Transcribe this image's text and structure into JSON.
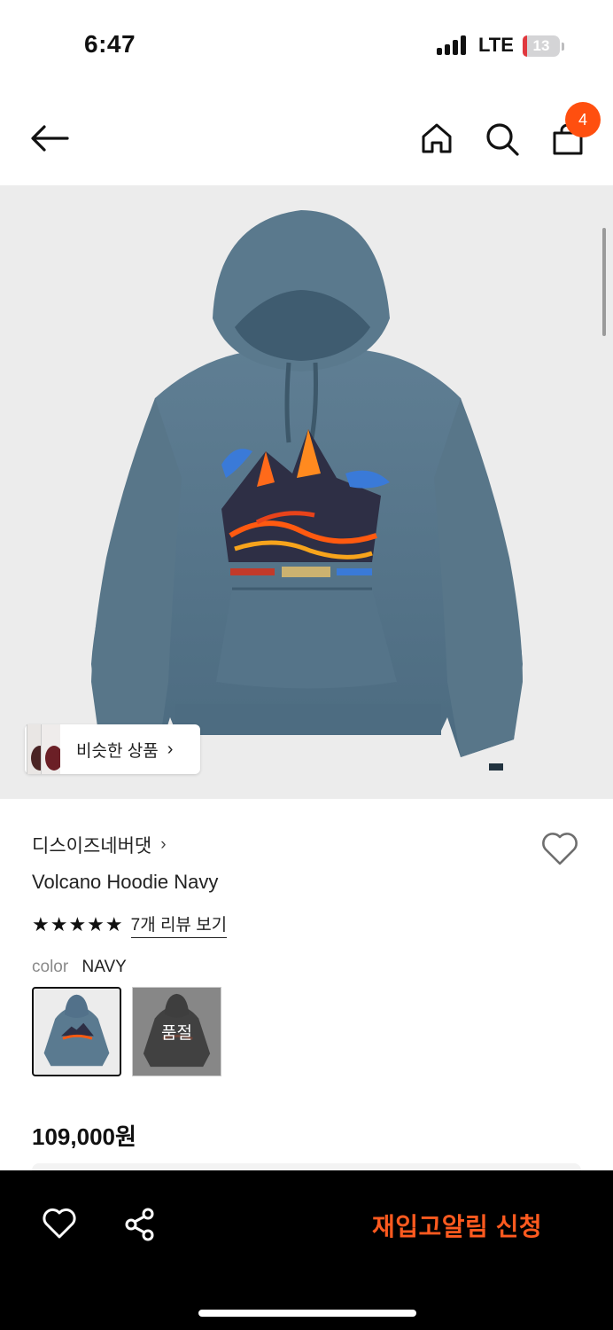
{
  "status_bar": {
    "time": "6:47",
    "network": "LTE",
    "battery_level": "13",
    "battery_fraction": 0.13
  },
  "header": {
    "back_icon": "arrow-left-icon",
    "home_icon": "home-icon",
    "search_icon": "search-icon",
    "cart_icon": "shopping-bag-icon",
    "cart_count": "4",
    "badge_color": "#ff4f0f"
  },
  "product": {
    "similar_button_label": "비슷한 상품",
    "brand": "디스이즈네버댓",
    "name": "Volcano Hoodie Navy",
    "rating_stars": 5,
    "review_link": "7개 리뷰 보기",
    "option_key": "color",
    "option_value": "NAVY",
    "swatches": [
      {
        "color": "navy",
        "selected": true,
        "sold_out": false
      },
      {
        "color": "charcoal",
        "selected": false,
        "sold_out": true,
        "badge": "품절"
      }
    ],
    "price": "109,000원"
  },
  "bottom_bar": {
    "wish_icon": "heart-icon",
    "share_icon": "share-icon",
    "cta_label": "재입고알림 신청",
    "cta_color": "#ff5a1f"
  }
}
